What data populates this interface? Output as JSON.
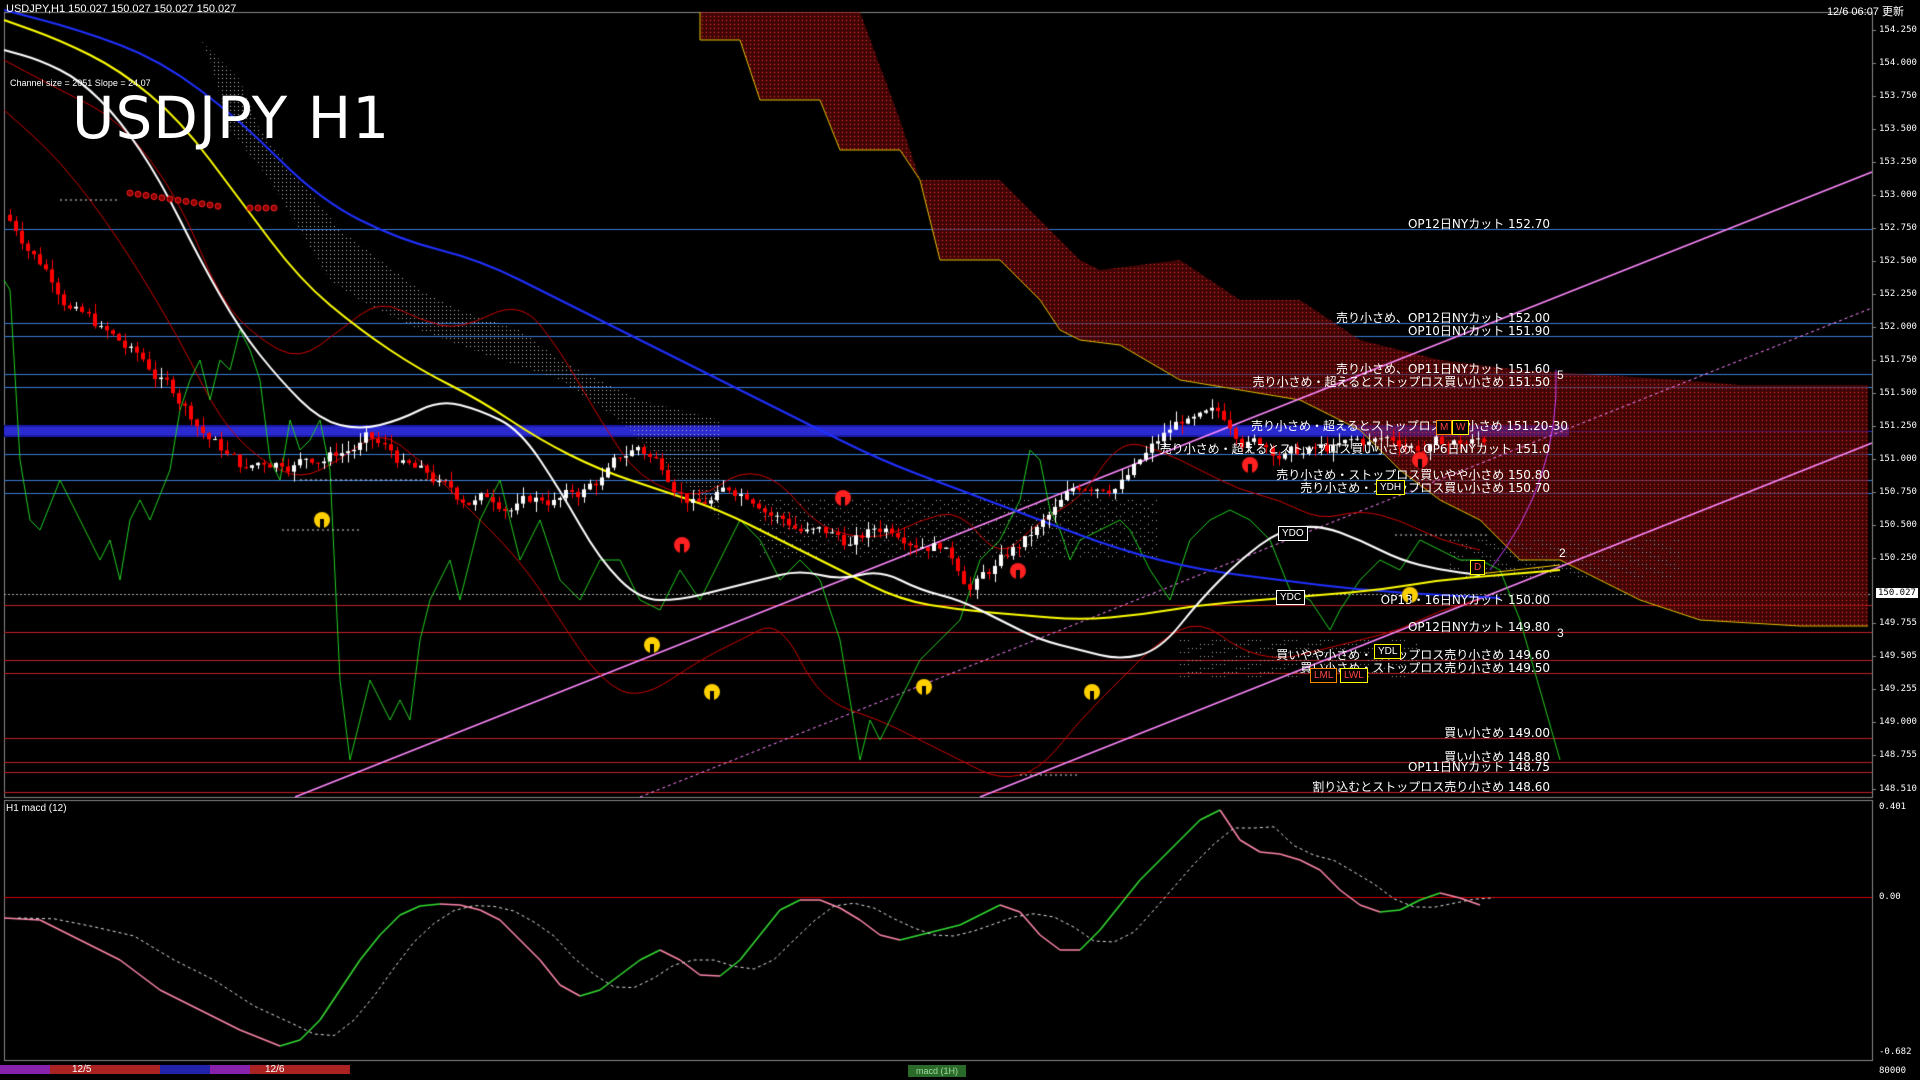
{
  "header": {
    "symbol_info": "USDJPY,H1  150.027 150.027 150.027 150.027",
    "datetime": "12/6 06:07 更新",
    "channel_info": "Channel size = 2051 Slope = 24.07",
    "big_title": "USDJPY H1"
  },
  "price_axis": [
    "154.250",
    "154.000",
    "153.750",
    "153.500",
    "153.250",
    "153.000",
    "152.750",
    "152.500",
    "152.250",
    "152.000",
    "151.750",
    "151.500",
    "151.250",
    "151.000",
    "150.750",
    "150.500",
    "150.250",
    "149.755",
    "149.505",
    "149.255",
    "149.000",
    "148.755",
    "148.510"
  ],
  "current_price": "150.027",
  "levels": [
    {
      "text": "OP12日NYカット 152.70",
      "color": "#3a7bd5"
    },
    {
      "text": "売り小さめ、OP12日NYカット 152.00",
      "color": "#3a7bd5"
    },
    {
      "text": "OP10日NYカット 151.90",
      "color": "#3a7bd5"
    },
    {
      "text": "売り小さめ、OP11日NYカット 151.60",
      "color": "#3a7bd5"
    },
    {
      "text": "売り小さめ・超えるとストップロス買い小さめ 151.50",
      "color": "#3a7bd5"
    },
    {
      "text": "売り小さめ・超えるとストップロス買い小さめ 151.20-30",
      "color": "#2020c0"
    },
    {
      "text": "売り小さめ・超えるとストップロス買い小さめ、OP6日NYカット 151.0",
      "color": "#3a7bd5"
    },
    {
      "text": "売り小さめ・ストップロス買いやや小さめ 150.80",
      "color": "#3a7bd5"
    },
    {
      "text": "売り小さめ・ストップロス買い小さめ 150.70",
      "color": "#3a7bd5"
    },
    {
      "text": "OP13・16日NYカット 150.00",
      "color": "#c02020"
    },
    {
      "text": "OP12日NYカット 149.80",
      "color": "#c02020"
    },
    {
      "text": "買いやや小さめ・ストップロス売り小さめ 149.60",
      "color": "#c02020"
    },
    {
      "text": "買い小さめ・ストップロス売り小さめ 149.50",
      "color": "#c02020"
    },
    {
      "text": "買い小さめ 149.00",
      "color": "#c02020"
    },
    {
      "text": "買い小さめ 148.80",
      "color": "#c02020"
    },
    {
      "text": "OP11日NYカット 148.75",
      "color": "#c02020"
    },
    {
      "text": "割り込むとストップロス売り小さめ 148.60",
      "color": "#c02020"
    }
  ],
  "side_numbers": [
    "5",
    "2",
    "3"
  ],
  "box_labels": [
    "YDO",
    "YDC",
    "YDH",
    "YDL",
    "LML",
    "LWL",
    "M",
    "W",
    "D"
  ],
  "macd": {
    "title": "H1  macd (12)",
    "axis": [
      "0.401",
      "0.00",
      "-0.682",
      "80000"
    ]
  },
  "bottom": {
    "dates": [
      "12/5",
      "12/6"
    ],
    "tab": "macd (1H)"
  },
  "colors": {
    "background": "#000000",
    "bull_candle": "#ffffff",
    "bear_candle": "#ff0000",
    "kumo": "#ff0000",
    "ma_fast": "#ffffff",
    "ma_mid": "#ffff00",
    "ma_slow": "#2030ff",
    "bollinger": "#cc0000",
    "chikou": "#22cc22",
    "channel": "#ff88ff",
    "macd_up": "#33dd33",
    "macd_down": "#ff88aa"
  }
}
